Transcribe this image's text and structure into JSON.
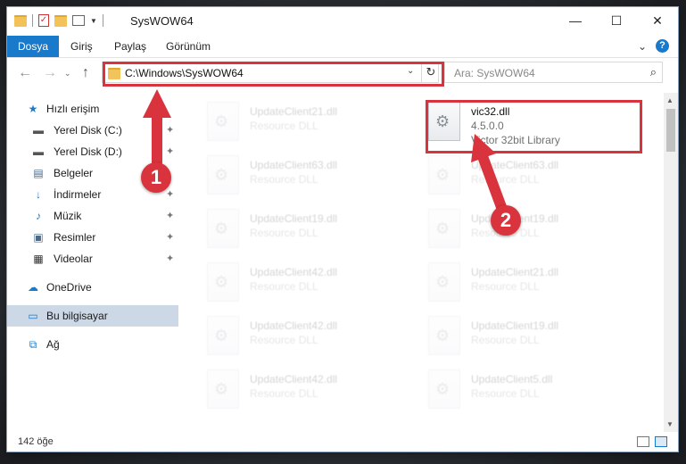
{
  "window": {
    "title": "SysWOW64",
    "minimize": "—",
    "maximize": "☐",
    "close": "✕"
  },
  "ribbon": {
    "file_tab": "Dosya",
    "tabs": [
      "Giriş",
      "Paylaş",
      "Görünüm"
    ],
    "expand": "⌄",
    "help": "?"
  },
  "address": {
    "path": "C:\\Windows\\SysWOW64",
    "search_placeholder": "Ara: SysWOW64"
  },
  "sidebar": {
    "quick_access": "Hızlı erişim",
    "items": [
      {
        "label": "Yerel Disk (C:)",
        "icon": "drive-icon"
      },
      {
        "label": "Yerel Disk (D:)",
        "icon": "drive-icon"
      },
      {
        "label": "Belgeler",
        "icon": "documents-icon"
      },
      {
        "label": "İndirmeler",
        "icon": "downloads-icon"
      },
      {
        "label": "Müzik",
        "icon": "music-icon"
      },
      {
        "label": "Resimler",
        "icon": "pictures-icon"
      },
      {
        "label": "Videolar",
        "icon": "videos-icon"
      }
    ],
    "onedrive": "OneDrive",
    "this_pc": "Bu bilgisayar",
    "network": "Ağ"
  },
  "files_left": [
    {
      "name": "UpdateClient21.dll",
      "desc": "Resource DLL"
    },
    {
      "name": "UpdateClient63.dll",
      "desc": "Resource DLL"
    },
    {
      "name": "UpdateClient19.dll",
      "desc": "Resource DLL"
    },
    {
      "name": "UpdateClient42.dll",
      "desc": "Resource DLL"
    },
    {
      "name": "UpdateClient42.dll",
      "desc": "Resource DLL"
    },
    {
      "name": "UpdateClient42.dll",
      "desc": "Resource DLL"
    }
  ],
  "files_right": [
    {
      "name": "UpdateClient63.dll",
      "desc": "Resource DLL"
    },
    {
      "name": "UpdateClient19.dll",
      "desc": "Resource DLL"
    },
    {
      "name": "UpdateClient21.dll",
      "desc": "Resource DLL"
    },
    {
      "name": "UpdateClient19.dll",
      "desc": "Resource DLL"
    },
    {
      "name": "UpdateClient5.dll",
      "desc": "Resource DLL"
    }
  ],
  "highlight_file": {
    "name": "vic32.dll",
    "version": "4.5.0.0",
    "desc": "Victor 32bit Library"
  },
  "callouts": [
    "1",
    "2"
  ],
  "status": {
    "count": "142 öğe"
  },
  "colors": {
    "accent": "#1979ca",
    "annotation": "#d9333d"
  }
}
